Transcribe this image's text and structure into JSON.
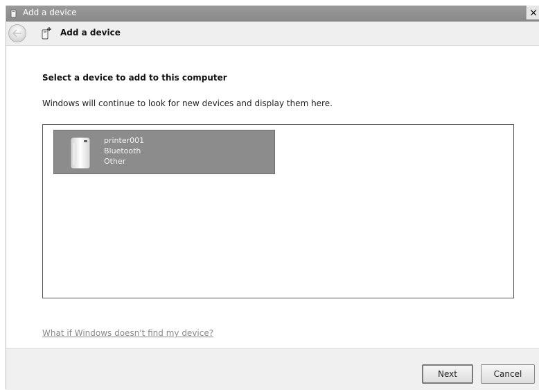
{
  "window": {
    "title": "Add a device",
    "close_glyph": "×",
    "icon": "device-add-icon"
  },
  "nav": {
    "title": "Add a device",
    "back_icon": "back-arrow-icon",
    "icon": "device-add-icon"
  },
  "content": {
    "heading": "Select a device to add to this computer",
    "subtext": "Windows will continue to look for new devices and display them here.",
    "devices": [
      {
        "name": "printer001",
        "connection": "Bluetooth",
        "category": "Other",
        "icon": "device-icon",
        "selected": true
      }
    ],
    "help_link": "What if Windows doesn't find my device?"
  },
  "footer": {
    "next_label": "Next",
    "cancel_label": "Cancel"
  },
  "colors": {
    "titlebar": "#8f8f8f",
    "selected_tile": "#8c8c8c",
    "link": "#8a8a8a"
  }
}
